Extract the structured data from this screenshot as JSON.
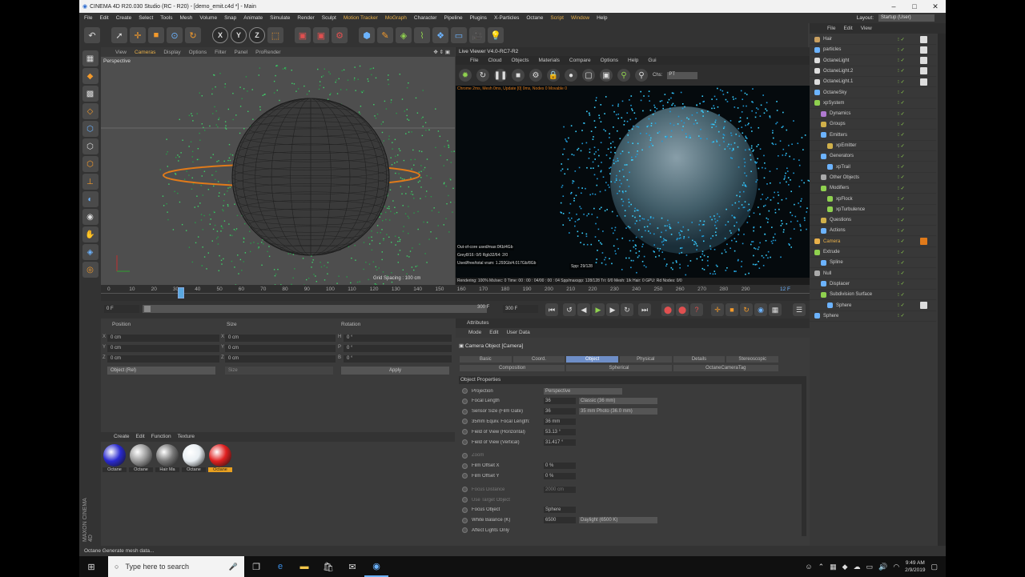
{
  "window": {
    "title": "CINEMA 4D R20.030 Studio (RC - R20) - [demo_emit.c4d *] - Main"
  },
  "menu": [
    "File",
    "Edit",
    "Create",
    "Select",
    "Tools",
    "Mesh",
    "Volume",
    "Snap",
    "Animate",
    "Simulate",
    "Render",
    "Sculpt",
    "Motion Tracker",
    "MoGraph",
    "Character",
    "Pipeline",
    "Plugins",
    "X-Particles",
    "Octane",
    "Script",
    "Window",
    "Help"
  ],
  "menu_highlight": [
    "Motion Tracker",
    "MoGraph",
    "Script",
    "Window"
  ],
  "layout": {
    "label": "Layout:",
    "value": "Startup (User)"
  },
  "viewport": {
    "tabs": [
      "View",
      "Cameras",
      "Display",
      "Options",
      "Filter",
      "Panel",
      "ProRender"
    ],
    "active": "Cameras",
    "label": "Perspective",
    "grid": "Grid Spacing : 100 cm"
  },
  "liveviewer": {
    "title": "Live Viewer V4.0-RC7-R2",
    "menu": [
      "File",
      "Cloud",
      "Objects",
      "Materials",
      "Compare",
      "Options",
      "Help",
      "Gui"
    ],
    "channel_label": "Chs:",
    "channel_value": "PT",
    "header_info": "Chrome 2ms, Mesh 0ms, Update [0] 0ms, Nodes 0 Movable 0",
    "overlay1": "Out-of-core used/max:0Kb/4Gb",
    "overlay2": "Grey8/16: 0/0        Rgb32/64: 2/0",
    "overlay3": "Used/free/total vram: 1.293Gb/4.017Gb/8Gb",
    "time_badge": "Spp: 29/128",
    "status": "Rendering: 100%  Ms/sec: 0   Time: 00 : 00 : 04/00 : 00 : 04   Spp/maxspp: 128/128   Tri: 0/0   Mesh: 1/k   Hair: 0   GPU:    Rd Nodes: 0/0"
  },
  "timeline": {
    "ticks": [
      "0",
      "10",
      "20",
      "30",
      "40",
      "50",
      "60",
      "70",
      "80",
      "90",
      "100",
      "110",
      "120",
      "130",
      "140",
      "150",
      "160",
      "170",
      "180",
      "190",
      "200",
      "210",
      "220",
      "230",
      "240",
      "250",
      "260",
      "270",
      "280",
      "290"
    ],
    "current": "12 F",
    "start": "0 F",
    "end": "300 F",
    "end2": "300 F"
  },
  "coords": {
    "headers": [
      "Position",
      "Size",
      "Rotation"
    ],
    "rows": [
      {
        "axis": "X",
        "pos": "0 cm",
        "size": "0 cm",
        "rlabel": "H",
        "rot": "0 °"
      },
      {
        "axis": "Y",
        "pos": "0 cm",
        "size": "0 cm",
        "rlabel": "P",
        "rot": "0 °"
      },
      {
        "axis": "Z",
        "pos": "0 cm",
        "size": "0 cm",
        "rlabel": "B",
        "rot": "0 °"
      }
    ],
    "mode": "Object (Rel)",
    "size_mode": "Size",
    "apply": "Apply"
  },
  "materials": {
    "menu": [
      "Create",
      "Edit",
      "Function",
      "Texture"
    ],
    "items": [
      {
        "name": "Octane",
        "color": "#2a2ad0"
      },
      {
        "name": "Octane",
        "color": "#9a9a9a"
      },
      {
        "name": "Hair Ma",
        "color": "#777777"
      },
      {
        "name": "Octane",
        "color": "#e8eef2"
      },
      {
        "name": "Octane",
        "color": "#e02020"
      }
    ]
  },
  "attributes": {
    "header": "Attributes",
    "menu": [
      "Mode",
      "Edit",
      "User Data"
    ],
    "object": "Camera Object [Camera]",
    "tabs1": [
      "Basic",
      "Coord.",
      "Object",
      "Physical",
      "Details",
      "Stereoscopic"
    ],
    "tabs2": [
      "Composition",
      "Spherical",
      "OctaneCameraTag"
    ],
    "active_tab": "Object",
    "section": "Object Properties",
    "props": [
      {
        "name": "Projection",
        "val": "",
        "dd": "Perspective",
        "dim": false
      },
      {
        "name": "Focal Length",
        "val": "36",
        "dd": "Classic (36 mm)",
        "dim": false
      },
      {
        "name": "Sensor Size (Film Gate)",
        "val": "36",
        "dd": "35 mm Photo (36.0 mm)",
        "dim": false
      },
      {
        "name": "35mm Equiv. Focal Length:",
        "val": "36 mm",
        "dd": "",
        "dim": false
      },
      {
        "name": "Field of View (Horizontal)",
        "val": "53.13 °",
        "dd": "",
        "dim": false
      },
      {
        "name": "Field of View (Vertical)",
        "val": "31.417 °",
        "dd": "",
        "dim": false
      },
      {
        "name": "Zoom",
        "val": "",
        "dd": "",
        "dim": true
      },
      {
        "name": "Film Offset X",
        "val": "0 %",
        "dd": "",
        "dim": false
      },
      {
        "name": "Film Offset Y",
        "val": "0 %",
        "dd": "",
        "dim": false
      },
      {
        "name": "Focus Distance",
        "val": "2000 cm",
        "dd": "",
        "dim": true
      },
      {
        "name": "Use Target Object",
        "val": "",
        "dd": "",
        "dim": true
      },
      {
        "name": "Focus Object",
        "val": "Sphere",
        "dd": "",
        "dim": false
      },
      {
        "name": "White Balance (K)",
        "val": "6500",
        "dd": "Daylight (6500 K)",
        "dim": false
      },
      {
        "name": "Affect Lights Only",
        "val": "",
        "dd": "",
        "dim": false
      }
    ]
  },
  "objects": {
    "menu": [
      "File",
      "Edit",
      "View"
    ],
    "items": [
      {
        "name": "Hair",
        "indent": 0,
        "color": "#c9a060"
      },
      {
        "name": "particles",
        "indent": 0,
        "color": "#6cb3ff"
      },
      {
        "name": "OctaneLight",
        "indent": 0,
        "color": "#dddddd"
      },
      {
        "name": "OctaneLight.2",
        "indent": 0,
        "color": "#dddddd"
      },
      {
        "name": "OctaneLight.1",
        "indent": 0,
        "color": "#dddddd"
      },
      {
        "name": "OctaneSky",
        "indent": 0,
        "color": "#6cb3ff"
      },
      {
        "name": "xpSystem",
        "indent": 0,
        "color": "#8fd14f"
      },
      {
        "name": "Dynamics",
        "indent": 1,
        "color": "#b07ad0"
      },
      {
        "name": "Groups",
        "indent": 1,
        "color": "#d0b04a"
      },
      {
        "name": "Emitters",
        "indent": 1,
        "color": "#6cb3ff"
      },
      {
        "name": "xpEmitter",
        "indent": 2,
        "color": "#d0b04a"
      },
      {
        "name": "Generators",
        "indent": 1,
        "color": "#6cb3ff"
      },
      {
        "name": "xpTrail",
        "indent": 2,
        "color": "#6cb3ff"
      },
      {
        "name": "Other Objects",
        "indent": 1,
        "color": "#aaaaaa"
      },
      {
        "name": "Modifiers",
        "indent": 1,
        "color": "#8fd14f"
      },
      {
        "name": "xpFlock",
        "indent": 2,
        "color": "#8fd14f"
      },
      {
        "name": "xpTurbulence",
        "indent": 2,
        "color": "#8fd14f"
      },
      {
        "name": "Questions",
        "indent": 1,
        "color": "#d0b04a"
      },
      {
        "name": "Actions",
        "indent": 1,
        "color": "#6cb3ff"
      },
      {
        "name": "Camera",
        "indent": 0,
        "color": "#e8b04a"
      },
      {
        "name": "Extrude",
        "indent": 0,
        "color": "#8fd14f"
      },
      {
        "name": "Spline",
        "indent": 1,
        "color": "#6cb3ff"
      },
      {
        "name": "Null",
        "indent": 0,
        "color": "#aaaaaa"
      },
      {
        "name": "Displacer",
        "indent": 1,
        "color": "#6cb3ff"
      },
      {
        "name": "Subdivision Surface",
        "indent": 1,
        "color": "#8fd14f"
      },
      {
        "name": "Sphere",
        "indent": 2,
        "color": "#6cb3ff"
      },
      {
        "name": "Sphere",
        "indent": 0,
        "color": "#6cb3ff"
      }
    ]
  },
  "status": "Octane Generate mesh data...",
  "taskbar": {
    "search_placeholder": "Type here to search",
    "time": "9:49 AM",
    "date": "2/9/2019"
  },
  "brand": "MAXON CINEMA 4D"
}
